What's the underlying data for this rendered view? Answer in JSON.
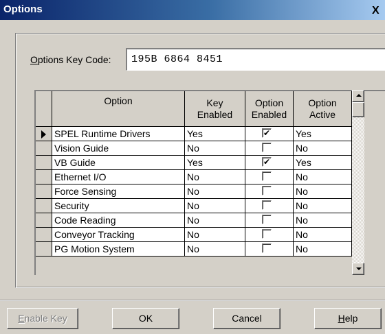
{
  "window": {
    "title": "Options",
    "close_glyph": "X"
  },
  "keycode": {
    "label_mnemonic": "O",
    "label_rest": "ptions Key Code:",
    "value": "195B 6864 8451"
  },
  "grid": {
    "columns": [
      "Option",
      "Key\nEnabled",
      "Option\nEnabled",
      "Option\nActive"
    ],
    "selected_row": 0,
    "rows": [
      {
        "option": "SPEL Runtime Drivers",
        "key_enabled": "Yes",
        "option_enabled": true,
        "option_active": "Yes"
      },
      {
        "option": "Vision Guide",
        "key_enabled": "No",
        "option_enabled": false,
        "option_active": "No"
      },
      {
        "option": "VB Guide",
        "key_enabled": "Yes",
        "option_enabled": true,
        "option_active": "Yes"
      },
      {
        "option": "Ethernet I/O",
        "key_enabled": "No",
        "option_enabled": false,
        "option_active": "No"
      },
      {
        "option": "Force Sensing",
        "key_enabled": "No",
        "option_enabled": false,
        "option_active": "No"
      },
      {
        "option": "Security",
        "key_enabled": "No",
        "option_enabled": false,
        "option_active": "No"
      },
      {
        "option": "Code Reading",
        "key_enabled": "No",
        "option_enabled": false,
        "option_active": "No"
      },
      {
        "option": "Conveyor Tracking",
        "key_enabled": "No",
        "option_enabled": false,
        "option_active": "No"
      },
      {
        "option": "PG Motion System",
        "key_enabled": "No",
        "option_enabled": false,
        "option_active": "No"
      }
    ]
  },
  "buttons": {
    "enable_key": {
      "mnemonic": "E",
      "rest": "nable Key",
      "disabled": true
    },
    "ok": {
      "label": "OK"
    },
    "cancel": {
      "label": "Cancel"
    },
    "help": {
      "mnemonic": "H",
      "rest": "elp"
    }
  },
  "icons": {
    "row_indicator": "right-triangle-icon",
    "checkmark": "check-icon"
  },
  "colors": {
    "titlebar_start": "#0a246a",
    "titlebar_end": "#a6caf0",
    "face": "#d4d0c8"
  }
}
